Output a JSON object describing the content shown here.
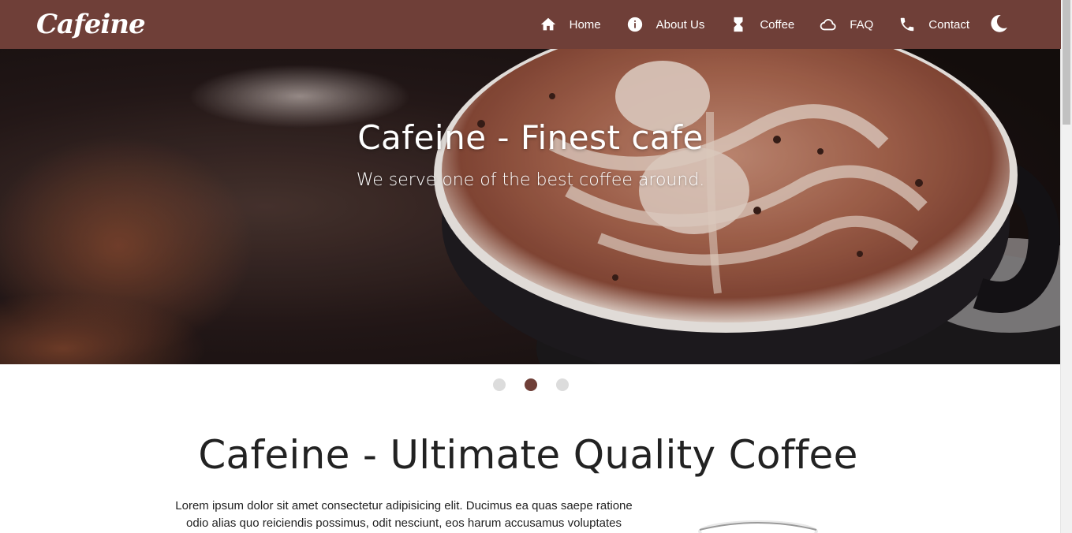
{
  "navbar": {
    "logo": "Cafeine",
    "links": [
      {
        "label": "Home",
        "icon": "home-icon"
      },
      {
        "label": "About Us",
        "icon": "info-icon"
      },
      {
        "label": "Coffee",
        "icon": "hourglass-icon"
      },
      {
        "label": "FAQ",
        "icon": "cloud-icon"
      },
      {
        "label": "Contact",
        "icon": "phone-icon"
      }
    ],
    "theme_toggle_icon": "moon-icon"
  },
  "hero": {
    "title": "Cafeine - Finest cafe",
    "subtitle": "We serve one of the best coffee around."
  },
  "carousel": {
    "slides_count": 3,
    "active_index": 1
  },
  "intro": {
    "title": "Cafeine - Ultimate Quality Coffee",
    "text": "Lorem ipsum dolor sit amet consectetur adipisicing elit. Ducimus ea quas saepe ratione odio alias quo reiciendis possimus, odit nesciunt, eos harum accusamus voluptates"
  },
  "colors": {
    "brand": "#6f3f38",
    "dot_inactive": "#dcdcdc",
    "text": "#222222"
  }
}
